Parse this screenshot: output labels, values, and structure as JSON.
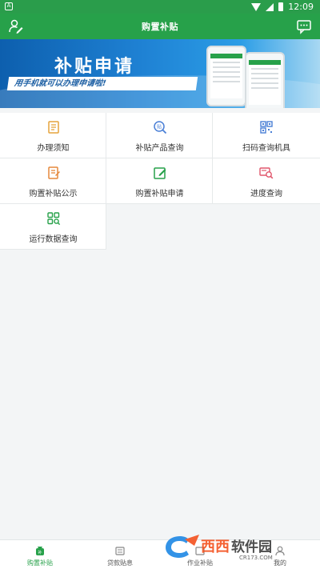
{
  "status_bar": {
    "time": "12:09",
    "left_badge": "A",
    "icons": [
      "notification-icon",
      "wifi-icon",
      "signal-icon",
      "battery-icon"
    ]
  },
  "app_bar": {
    "title": "购置补贴",
    "left_icon": "user-edit-icon",
    "right_icon": "message-icon"
  },
  "banner": {
    "title": "补贴申请",
    "subtitle": "用手机就可以办理申请啦!"
  },
  "menu": {
    "items": [
      {
        "label": "办理须知",
        "icon": "notice-document-icon",
        "color": "#e5a33c"
      },
      {
        "label": "补贴产品查询",
        "icon": "subsidy-search-icon",
        "color": "#4a7fd6"
      },
      {
        "label": "扫码查询机具",
        "icon": "qr-code-icon",
        "color": "#4a7fd6"
      },
      {
        "label": "购置补贴公示",
        "icon": "publicity-document-icon",
        "color": "#e5883c"
      },
      {
        "label": "购置补贴申请",
        "icon": "edit-form-icon",
        "color": "#27a14a"
      },
      {
        "label": "进度查询",
        "icon": "progress-search-icon",
        "color": "#e0566b"
      },
      {
        "label": "运行数据查询",
        "icon": "data-grid-search-icon",
        "color": "#27a14a"
      }
    ]
  },
  "bottom_nav": {
    "items": [
      {
        "label": "购置补贴",
        "icon": "subsidy-bag-icon",
        "active": true
      },
      {
        "label": "贷款贴息",
        "icon": "loan-icon",
        "active": false
      },
      {
        "label": "作业补贴",
        "icon": "work-subsidy-icon",
        "active": false
      },
      {
        "label": "我的",
        "icon": "profile-icon",
        "active": false
      }
    ]
  },
  "watermark": {
    "brand": "西西软件园",
    "url": "CR173.COM",
    "logo_text": "C"
  },
  "colors": {
    "primary": "#27a14a",
    "status_bar": "#2a9d4b",
    "background": "#f3f5f6"
  }
}
